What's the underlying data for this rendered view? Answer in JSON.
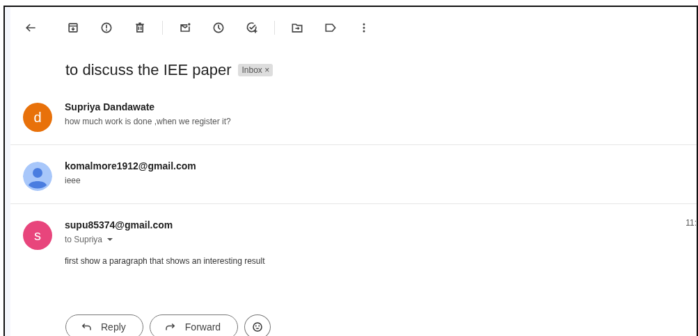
{
  "subject": "to discuss the IEE paper",
  "label": {
    "text": "Inbox",
    "remove": "×"
  },
  "messages": [
    {
      "kind": "collapsed",
      "avatar": {
        "kind": "letter",
        "letter": "d",
        "color": "#e8710a"
      },
      "sender": "Supriya Dandawate",
      "snippet": "how much work is done ,when we register it?"
    },
    {
      "kind": "collapsed",
      "avatar": {
        "kind": "person",
        "color": "#a8c7fa"
      },
      "sender": "komalmore1912@gmail.com",
      "snippet": "ieee"
    },
    {
      "kind": "expanded",
      "avatar": {
        "kind": "letter",
        "letter": "s",
        "color": "#e8457c"
      },
      "sender": "supu85374@gmail.com",
      "time": "11:",
      "recipient": "to Supriya",
      "body": "first show a paragraph that shows an interesting result"
    }
  ],
  "actions": [
    {
      "kind": "reply",
      "label": "Reply"
    },
    {
      "kind": "forward",
      "label": "Forward"
    },
    {
      "kind": "emoji"
    }
  ]
}
